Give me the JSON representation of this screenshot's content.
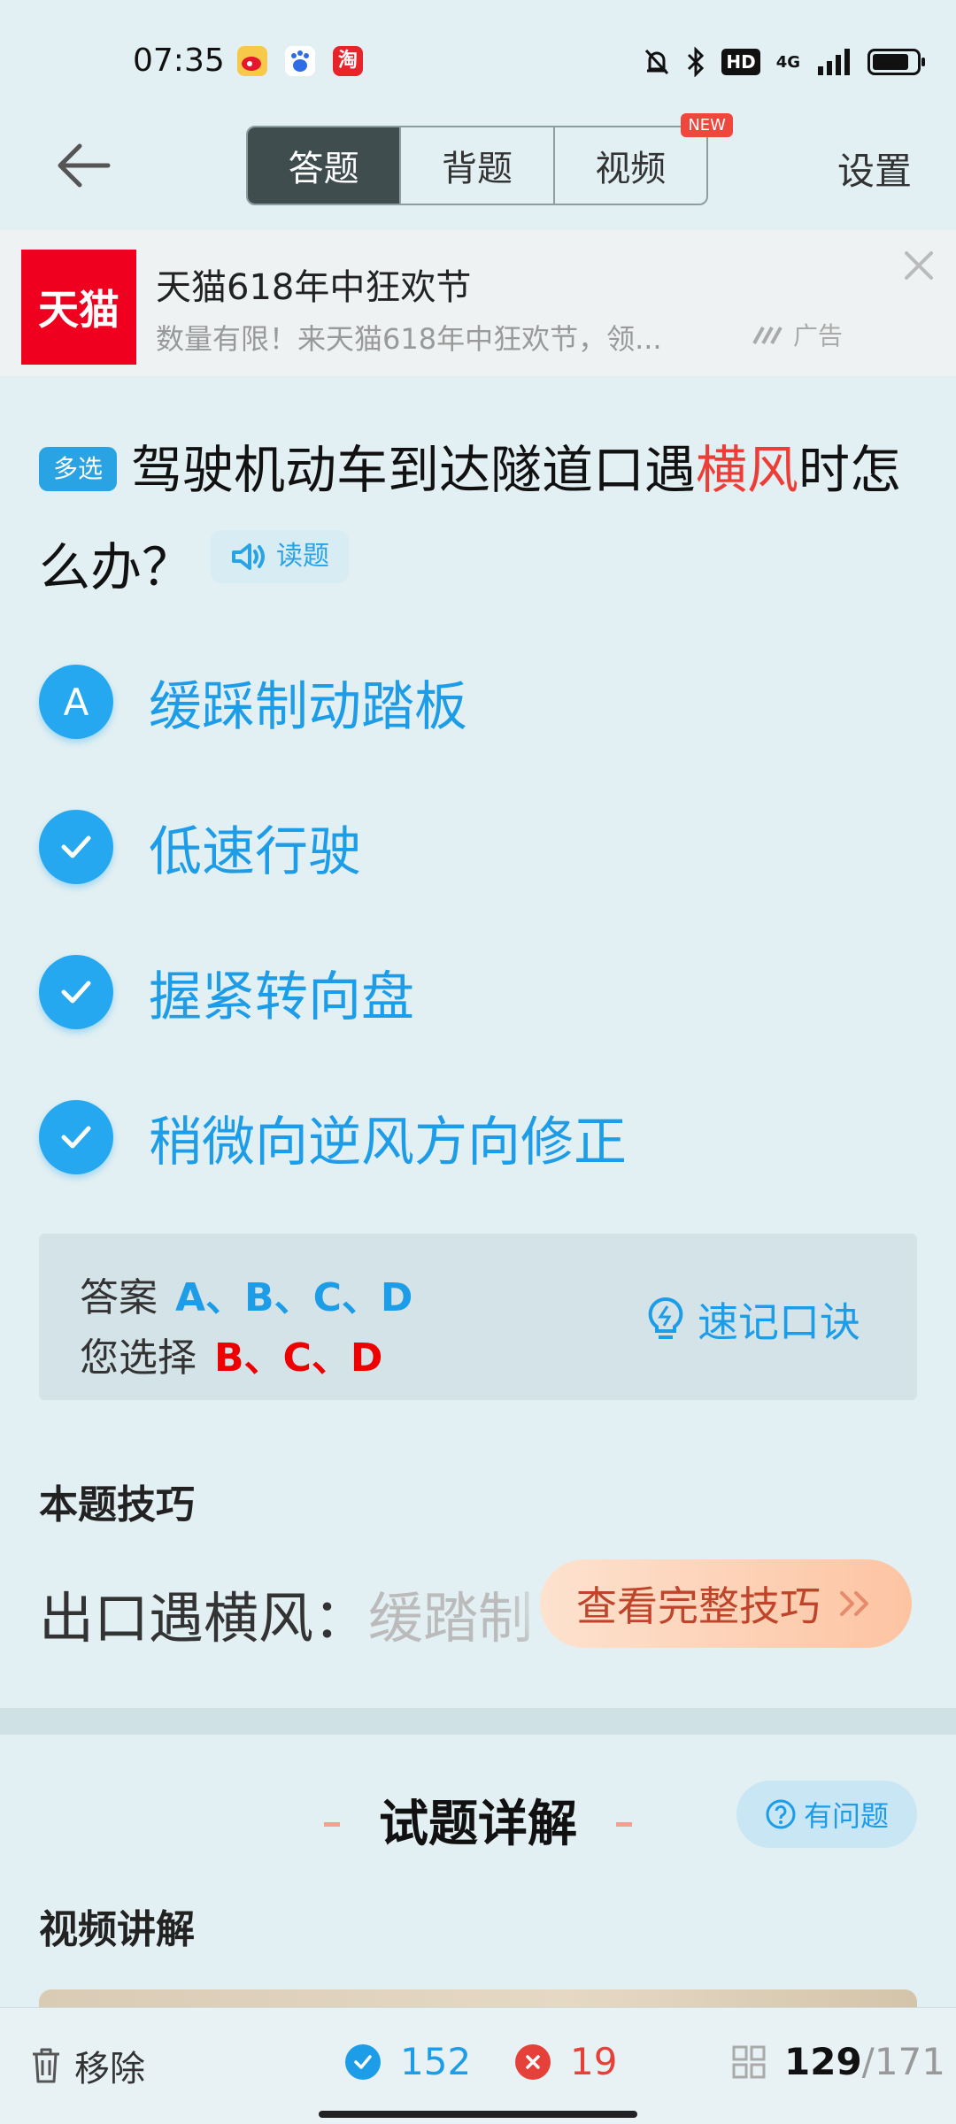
{
  "status_bar": {
    "time": "07:35",
    "apps": [
      {
        "icon": "weibo-icon",
        "color": "#f5a623"
      },
      {
        "icon": "baidu-icon",
        "color": "#2e6be6"
      },
      {
        "icon": "taobao-icon",
        "color": "#e8242b",
        "glyph": "淘"
      }
    ],
    "hd": "HD",
    "network": "4G"
  },
  "header": {
    "tabs": [
      {
        "label": "答题",
        "active": true
      },
      {
        "label": "背题",
        "active": false
      },
      {
        "label": "视频",
        "active": false,
        "badge": "NEW"
      }
    ],
    "settings": "设置"
  },
  "ad": {
    "logo_text": "天猫",
    "title": "天猫618年中狂欢节",
    "description": "数量有限！来天猫618年中狂欢节，领...",
    "tag": "广告"
  },
  "question": {
    "type": "多选",
    "text_before": "驾驶机动车到达隧道口遇",
    "highlight": "横风",
    "text_after": "时怎么办？",
    "read_label": "读题"
  },
  "options": [
    {
      "marker": "A",
      "text": "缓踩制动踏板",
      "checked": false
    },
    {
      "marker": "B",
      "text": "低速行驶",
      "checked": true
    },
    {
      "marker": "C",
      "text": "握紧转向盘",
      "checked": true
    },
    {
      "marker": "D",
      "text": "稍微向逆风方向修正",
      "checked": true
    }
  ],
  "answer": {
    "answer_label": "答案",
    "answer_value": "A、B、C、D",
    "choice_label": "您选择",
    "choice_value": "B、C、D",
    "mnemonic_label": "速记口诀"
  },
  "tip": {
    "heading": "本题技巧",
    "text_visible": "出口遇横风：",
    "text_faded": "缓踏制",
    "button_label": "查看完整技巧"
  },
  "explanation": {
    "title": "试题详解",
    "report_label": "有问题",
    "video_heading": "视频讲解"
  },
  "bottom_bar": {
    "remove_label": "移除",
    "correct_count": "152",
    "wrong_count": "19",
    "current": "129",
    "total": "/171"
  },
  "colors": {
    "accent": "#1d9ce8",
    "error": "#e00000",
    "highlight": "#ee3d36",
    "background": "#e3f0f3"
  }
}
